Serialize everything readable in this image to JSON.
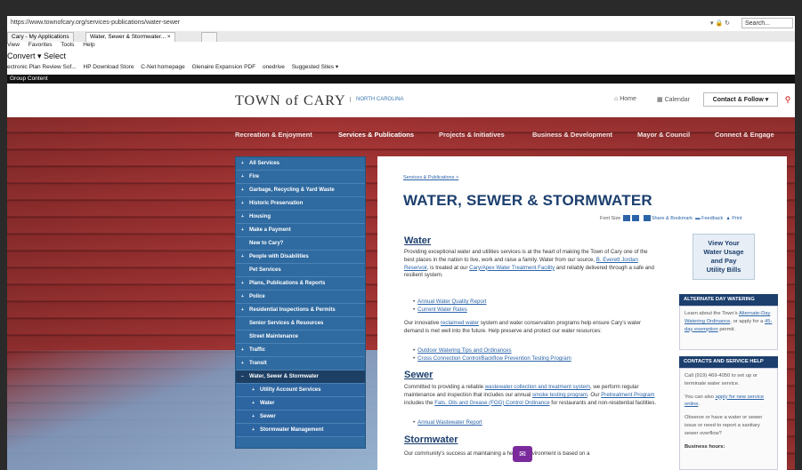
{
  "browser": {
    "url": "https://www.townofcary.org/services-publications/water-sewer",
    "address_controls": "▾ 🔒 ↻",
    "search_placeholder": "Search...",
    "tabs": [
      "Cary - My Applications",
      "Water, Sewer & Stormwater... ×"
    ],
    "menu": [
      "View",
      "Favorites",
      "Tools",
      "Help"
    ],
    "convert_label": "Convert ▾ Select",
    "favorites": [
      "ectronic Plan Review Sof...",
      "HP Download Store",
      "C-Net homepage",
      "Glenaire Expansion PDF",
      "onedrive",
      "Suggested Sites ▾"
    ],
    "group_bar": "Group Content"
  },
  "site": {
    "logo": "TOWN of CARY",
    "logo_sub": "NORTH CAROLINA",
    "home": "Home",
    "calendar": "Calendar",
    "contact": "Contact & Follow ▾",
    "search_icon": "search-icon",
    "nav": [
      "Recreation & Enjoyment",
      "Services & Publications",
      "Projects & Initiatives",
      "Business & Development",
      "Mayor & Council",
      "Connect & Engage"
    ],
    "nav_active": "Services & Publications"
  },
  "sidebar": {
    "items": [
      {
        "label": "All Services",
        "arrow": "+"
      },
      {
        "label": "Fire",
        "arrow": "+"
      },
      {
        "label": "Garbage, Recycling & Yard Waste",
        "arrow": "+"
      },
      {
        "label": "Historic Preservation",
        "arrow": "+"
      },
      {
        "label": "Housing",
        "arrow": "+"
      },
      {
        "label": "Make a Payment",
        "arrow": "+"
      },
      {
        "label": "New to Cary?",
        "arrow": ""
      },
      {
        "label": "People with Disabilities",
        "arrow": "+"
      },
      {
        "label": "Pet Services",
        "arrow": ""
      },
      {
        "label": "Plans, Publications & Reports",
        "arrow": "+"
      },
      {
        "label": "Police",
        "arrow": "+"
      },
      {
        "label": "Residential Inspections & Permits",
        "arrow": "+"
      },
      {
        "label": "Senior Services & Resources",
        "arrow": ""
      },
      {
        "label": "Street Maintenance",
        "arrow": ""
      },
      {
        "label": "Traffic",
        "arrow": "+"
      },
      {
        "label": "Transit",
        "arrow": "+"
      },
      {
        "label": "Water, Sewer & Stormwater",
        "arrow": "−"
      },
      {
        "label": "Utility Account Services",
        "arrow": "+"
      },
      {
        "label": "Water",
        "arrow": "+"
      },
      {
        "label": "Sewer",
        "arrow": "+"
      },
      {
        "label": "Stormwater Management",
        "arrow": "+"
      }
    ]
  },
  "content": {
    "breadcrumb": "Services & Publications >",
    "title": "WATER, SEWER & STORMWATER",
    "tools": {
      "font_size": "Font Size",
      "share": "Share & Bookmark",
      "feedback": "Feedback",
      "print": "Print"
    },
    "water": {
      "heading": "Water",
      "p1_a": "Providing exceptional water and utilities services is at the heart of making the Town of Cary one of the best places in the nation to live, work and raise a family. Water from our source, ",
      "p1_link1": "B. Everett Jordan Reservoir",
      "p1_b": ", is treated at our ",
      "p1_link2": "Cary/Apex Water Treatment Facility",
      "p1_c": " and reliably delivered through a safe and resilient system.",
      "bullets1": [
        "Annual Water Quality Report",
        "Current Water Rates"
      ],
      "p2_a": "Our innovative ",
      "p2_link": "reclaimed water",
      "p2_b": " system and water conservation programs help ensure Cary's water demand is met well into the future. Help preserve and protect our water resources:",
      "bullets2": [
        "Outdoor Watering Tips and Ordinances",
        "Cross Connection Control/Backflow Prevention Testing Program"
      ]
    },
    "sewer": {
      "heading": "Sewer",
      "p_a": "Committed to providing a reliable ",
      "p_link1": "wastewater collection and treatment system",
      "p_b": ", we perform regular maintenance and inspection that includes our annual ",
      "p_link2": "smoke testing program",
      "p_c": ". Our ",
      "p_link3": "Pretreatment Program",
      "p_d": " includes the ",
      "p_link4": "Fats, Oils and Grease (FOG) Control Ordinance",
      "p_e": " for restaurants and non-residential facilities.",
      "bullets": [
        "Annual Wastewater Report"
      ]
    },
    "stormwater": {
      "heading": "Stormwater",
      "p": "Our community's success at maintaining a healthy environment is based on a"
    }
  },
  "rail": {
    "usage_button": [
      "View Your",
      "Water Usage",
      "and Pay",
      "Utility Bills"
    ],
    "alt_heading": "ALTERNATE DAY WATERING",
    "alt_a": "Learn about the Town's ",
    "alt_link1": "Alternate-Day Watering Ordinance",
    "alt_b": ", or apply for a ",
    "alt_link2": "45-day exemption",
    "alt_c": " permit.",
    "contact_heading": "CONTACTS AND SERVICE HELP",
    "contact_p1": "Call (919) 469-4050 to set up or terminate water service.",
    "contact_p2_a": "You can also ",
    "contact_p2_link": "apply for new service online",
    "contact_p2_b": ".",
    "contact_p3": "Observe or have a water or sewer issue or need to report a sanitary sewer overflow?",
    "contact_p4": "Business hours:"
  },
  "chat_icon": "chat-bubble-icon"
}
